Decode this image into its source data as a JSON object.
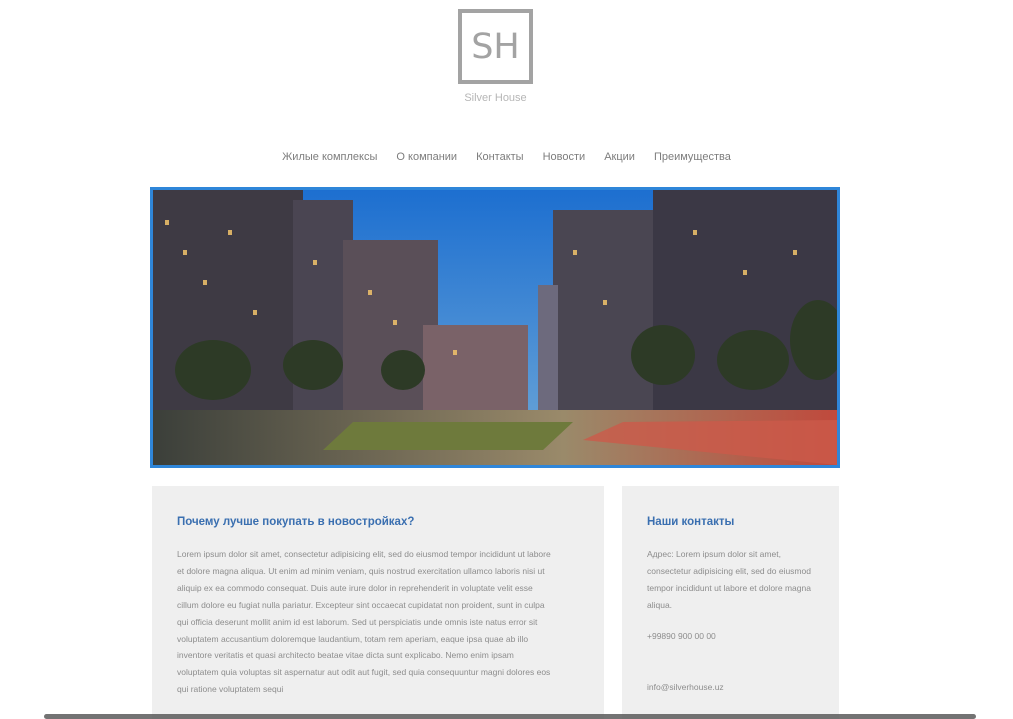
{
  "brand": {
    "logo_text": "SH",
    "name": "Silver House"
  },
  "nav": {
    "items": [
      {
        "label": "Жилые комплексы"
      },
      {
        "label": "О компании"
      },
      {
        "label": "Контакты"
      },
      {
        "label": "Новости"
      },
      {
        "label": "Акции"
      },
      {
        "label": "Преимущества"
      }
    ]
  },
  "main_card": {
    "title": "Почему лучше покупать в новостройках?",
    "body": "Lorem ipsum dolor sit amet, consectetur adipisicing elit, sed do eiusmod tempor incididunt ut labore et dolore magna aliqua. Ut enim ad minim veniam, quis nostrud exercitation ullamco laboris nisi ut aliquip ex ea commodo consequat. Duis aute irure dolor in reprehenderit in voluptate velit esse cillum dolore eu fugiat nulla pariatur. Excepteur sint occaecat cupidatat non proident, sunt in culpa qui officia deserunt mollit anim id est laborum. Sed ut perspiciatis unde omnis iste natus error sit voluptatem accusantium doloremque laudantium, totam rem aperiam, eaque ipsa quae ab illo inventore veritatis et quasi architecto beatae vitae dicta sunt explicabo. Nemo enim ipsam voluptatem quia voluptas sit aspernatur aut odit aut fugit, sed quia consequuntur magni dolores eos qui ratione voluptatem sequi"
  },
  "contacts_card": {
    "title": "Наши контакты",
    "address": "Адрес: Lorem ipsum dolor sit amet, consectetur adipisicing elit, sed do eiusmod tempor incididunt ut labore et dolore magna aliqua.",
    "phone": "+99890 900 00 00",
    "email": "info@silverhouse.uz"
  },
  "colors": {
    "accent": "#2f86d9",
    "heading": "#3a6fb0",
    "card_bg": "#efefef"
  },
  "hero": {
    "icon": "night-residential-complex-image"
  }
}
